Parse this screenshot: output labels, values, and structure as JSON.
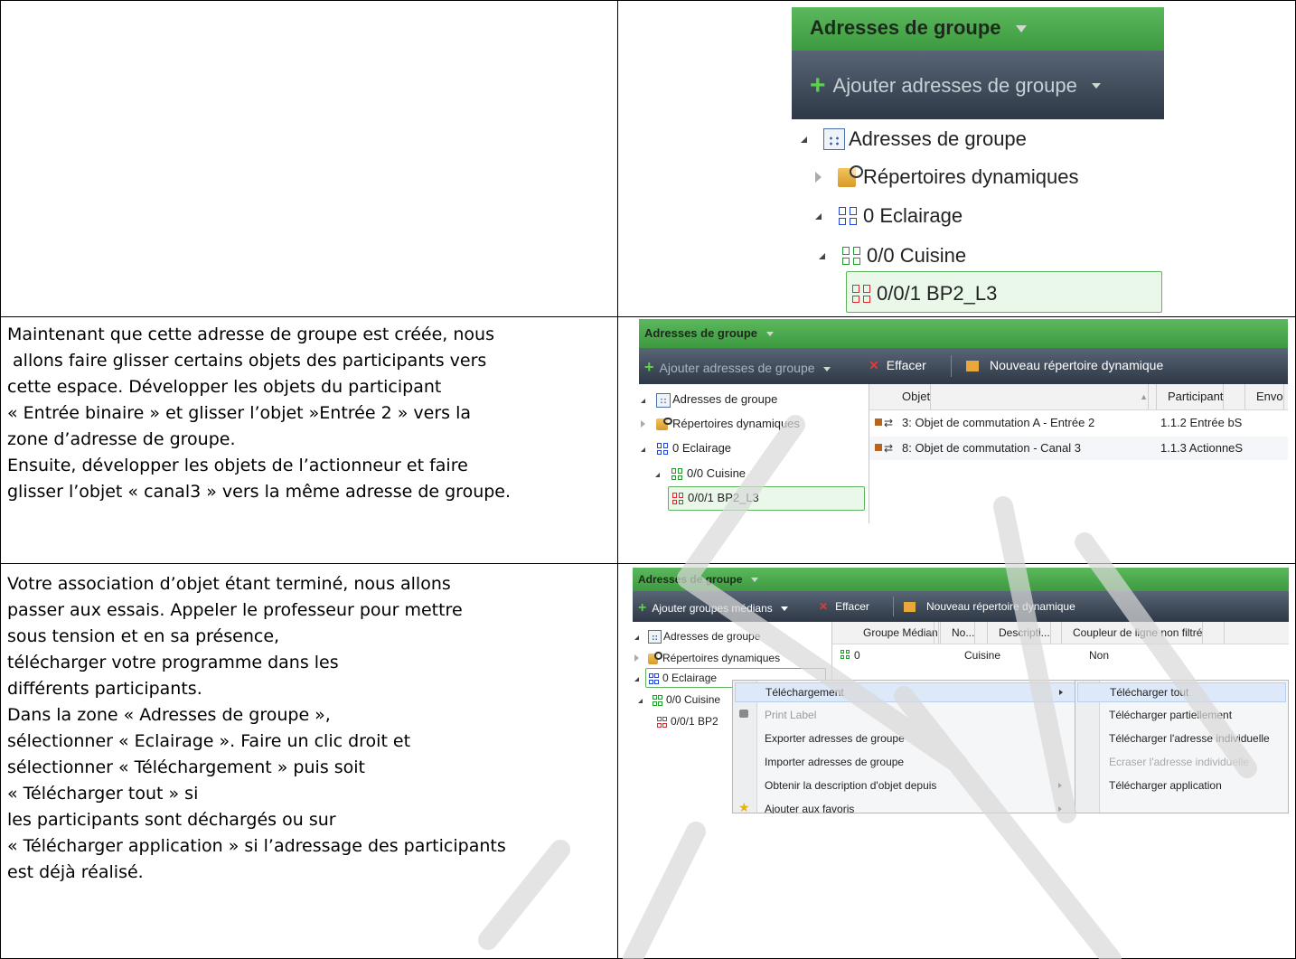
{
  "rows": [
    {
      "paragraphs": []
    },
    {
      "paragraphs": [
        "Maintenant que cette adresse de groupe est créée, nous",
        " allons faire glisser certains objets des participants vers",
        "cette espace. Développer les objets du participant",
        "« Entrée binaire » et glisser l’objet »Entrée 2 » vers la",
        "zone d’adresse de groupe.",
        "Ensuite, développer les objets de l’actionneur et faire",
        "glisser l’objet « canal3 » vers la même adresse de groupe."
      ]
    },
    {
      "paragraphs": [
        "Votre association d’objet étant terminé, nous allons",
        "passer aux essais. Appeler le professeur pour mettre",
        "sous tension et en sa présence,",
        "télécharger votre programme dans les",
        "différents participants.",
        "Dans la zone « Adresses de groupe »,",
        "sélectionner « Eclairage ». Faire un clic droit et",
        "sélectionner « Téléchargement » puis soit",
        "« Télécharger tout » si",
        "les participants sont déchargés ou sur",
        "« Télécharger application » si l’adressage des participants",
        "est déjà réalisé."
      ]
    }
  ],
  "shot1": {
    "header": "Adresses de groupe",
    "add_button": "Ajouter adresses de groupe",
    "tree": [
      "Adresses de groupe",
      "Répertoires dynamiques",
      "0 Eclairage",
      "0/0 Cuisine",
      "0/0/1 BP2_L3"
    ]
  },
  "shot2": {
    "header": "Adresses de groupe",
    "add_button": "Ajouter adresses de groupe",
    "delete_button": "Effacer",
    "new_dir_button": "Nouveau répertoire dynamique",
    "tree": [
      "Adresses de groupe",
      "Répertoires dynamiques",
      "0 Eclairage",
      "0/0 Cuisine",
      "0/0/1 BP2_L3"
    ],
    "columns": [
      "Objet",
      "Participant",
      "Envo"
    ],
    "rows": [
      {
        "objet": "3: Objet de commutation A - Entrée 2",
        "participant": "1.1.2  Entrée bS"
      },
      {
        "objet": "8: Objet de commutation - Canal 3",
        "participant": "1.1.3  ActionneS"
      }
    ]
  },
  "shot3": {
    "header": "Adresses de groupe",
    "add_button": "Ajouter groupes médians",
    "delete_button": "Effacer",
    "new_dir_button": "Nouveau répertoire dynamique",
    "tree": [
      "Adresses de groupe",
      "Répertoires dynamiques",
      "0 Eclairage",
      "0/0 Cuisine",
      "0/0/1 BP2"
    ],
    "columns": [
      "Groupe Médian",
      "No...",
      "Descripti...",
      "Coupleur de ligne non filtré"
    ],
    "row": {
      "groupe": "0",
      "description": "Cuisine",
      "coupleur": "Non"
    },
    "context_menu": [
      "Téléchargement",
      "Print Label",
      "Exporter adresses de groupe",
      "Importer adresses de groupe",
      "Obtenir la description d'objet depuis",
      "Ajouter aux favoris"
    ],
    "submenu": [
      "Télécharger tout",
      "Télécharger partiellement",
      "Télécharger l'adresse individuelle",
      "Ecraser l'adresse individuelle",
      "Télécharger application"
    ]
  }
}
